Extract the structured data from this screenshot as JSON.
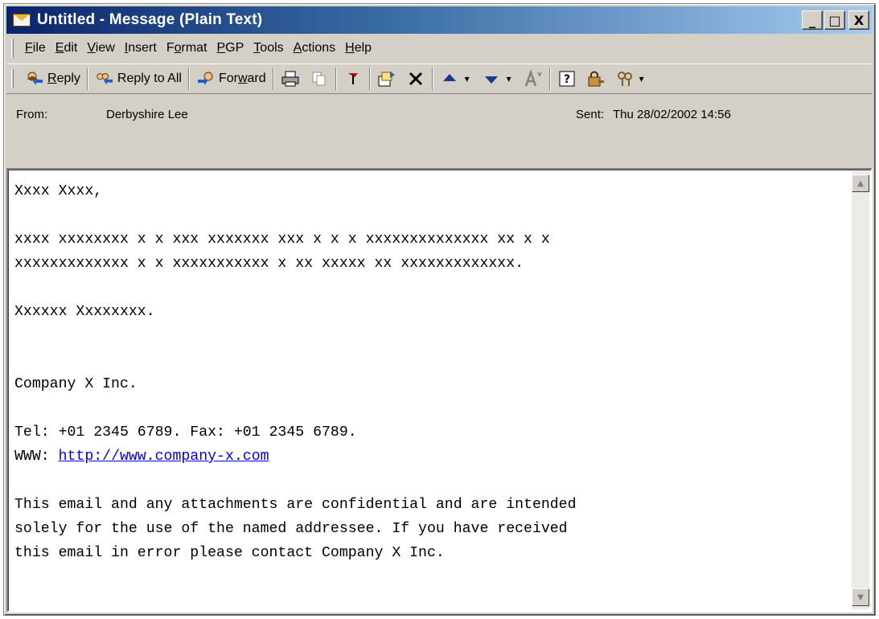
{
  "window": {
    "title": "Untitled - Message (Plain Text)",
    "minimize": "_",
    "maximize": "□",
    "close": "X"
  },
  "menu": [
    {
      "pre": "",
      "key": "F",
      "post": "ile"
    },
    {
      "pre": "",
      "key": "E",
      "post": "dit"
    },
    {
      "pre": "",
      "key": "V",
      "post": "iew"
    },
    {
      "pre": "",
      "key": "I",
      "post": "nsert"
    },
    {
      "pre": "F",
      "key": "o",
      "post": "rmat"
    },
    {
      "pre": "",
      "key": "P",
      "post": "GP"
    },
    {
      "pre": "",
      "key": "T",
      "post": "ools"
    },
    {
      "pre": "",
      "key": "A",
      "post": "ctions"
    },
    {
      "pre": "",
      "key": "H",
      "post": "elp"
    }
  ],
  "toolbar": {
    "reply_pre": "",
    "reply_key": "R",
    "reply_post": "eply",
    "reply_all": "Reply to All",
    "forward_pre": "For",
    "forward_key": "w",
    "forward_post": "ard"
  },
  "header": {
    "from_label": "From:",
    "from_value": "Derbyshire Lee",
    "sent_label": "Sent:",
    "sent_value": "Thu 28/02/2002 14:56"
  },
  "message": {
    "greeting": "Xxxx Xxxx,",
    "para1_line1": "xxxx xxxxxxxx x x xxx xxxxxxx xxx x x x xxxxxxxxxxxxxx xx x x",
    "para1_line2": "xxxxxxxxxxxxx x x xxxxxxxxxxx x xx xxxxx xx xxxxxxxxxxxxx.",
    "signoff": "Xxxxxx Xxxxxxxx.",
    "company": "Company X Inc.",
    "tel": "Tel: +01 2345 6789. Fax: +01 2345 6789.",
    "www_label": "WWW: ",
    "www_url": "http://www.company-x.com",
    "disclaimer_1": "This email and any attachments are confidential and are intended",
    "disclaimer_2": "solely for the use of the named addressee. If you have received",
    "disclaimer_3": "this email in error please contact Company X Inc."
  },
  "colors": {
    "titlebar_start": "#0a246a",
    "titlebar_end": "#a6caf0",
    "link": "#0000ee",
    "chrome": "#d4d0c8"
  }
}
